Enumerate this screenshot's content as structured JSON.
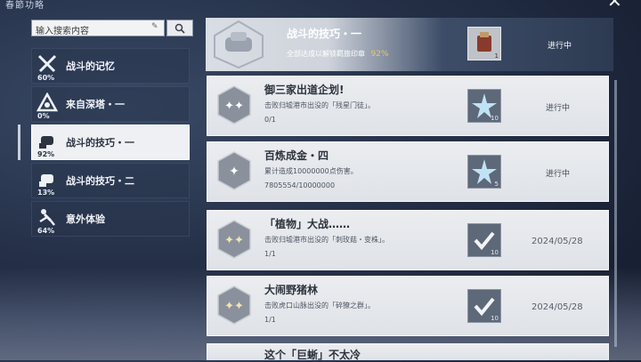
{
  "window": {
    "title": "春節功略"
  },
  "search": {
    "placeholder": "输入搜索内容"
  },
  "sidebar": {
    "items": [
      {
        "label": "战斗的记忆",
        "percent": "60%"
      },
      {
        "label": "来自深塔・一",
        "percent": "0%"
      },
      {
        "label": "战斗的技巧・一",
        "percent": "92%"
      },
      {
        "label": "战斗的技巧・二",
        "percent": "13%"
      },
      {
        "label": "意外体验",
        "percent": "64%"
      }
    ]
  },
  "summary": {
    "title": "战斗的技巧・一",
    "subtitle": "全部达成以解锁羁旅印章",
    "percent": "92%",
    "reward_count": "1",
    "status": "进行中"
  },
  "tasks": [
    {
      "title": "御三家出道企划!",
      "desc": "击败归墟港市出没的「残星门徒」。",
      "progress": "0/1",
      "reward_count": "10",
      "status": "进行中",
      "date": ""
    },
    {
      "title": "百炼成金・四",
      "desc": "累计造成10000000点伤害。",
      "progress": "7805554/10000000",
      "reward_count": "5",
      "status": "进行中",
      "date": ""
    },
    {
      "title": "「植物」大战……",
      "desc": "击败归墟港市出没的「刺玫菇・变株」。",
      "progress": "1/1",
      "reward_count": "10",
      "status": "",
      "date": "2024/05/28"
    },
    {
      "title": "大闹野猪林",
      "desc": "击败虎口山脉出没的「碎獠之群」。",
      "progress": "1/1",
      "reward_count": "10",
      "status": "",
      "date": "2024/05/28"
    },
    {
      "title": "这个「巨蜥」不太冷"
    }
  ],
  "colors": {
    "accent_gold": "#e8c766",
    "panel_light": "#ebedf0",
    "bg_dark": "#1f2940"
  }
}
